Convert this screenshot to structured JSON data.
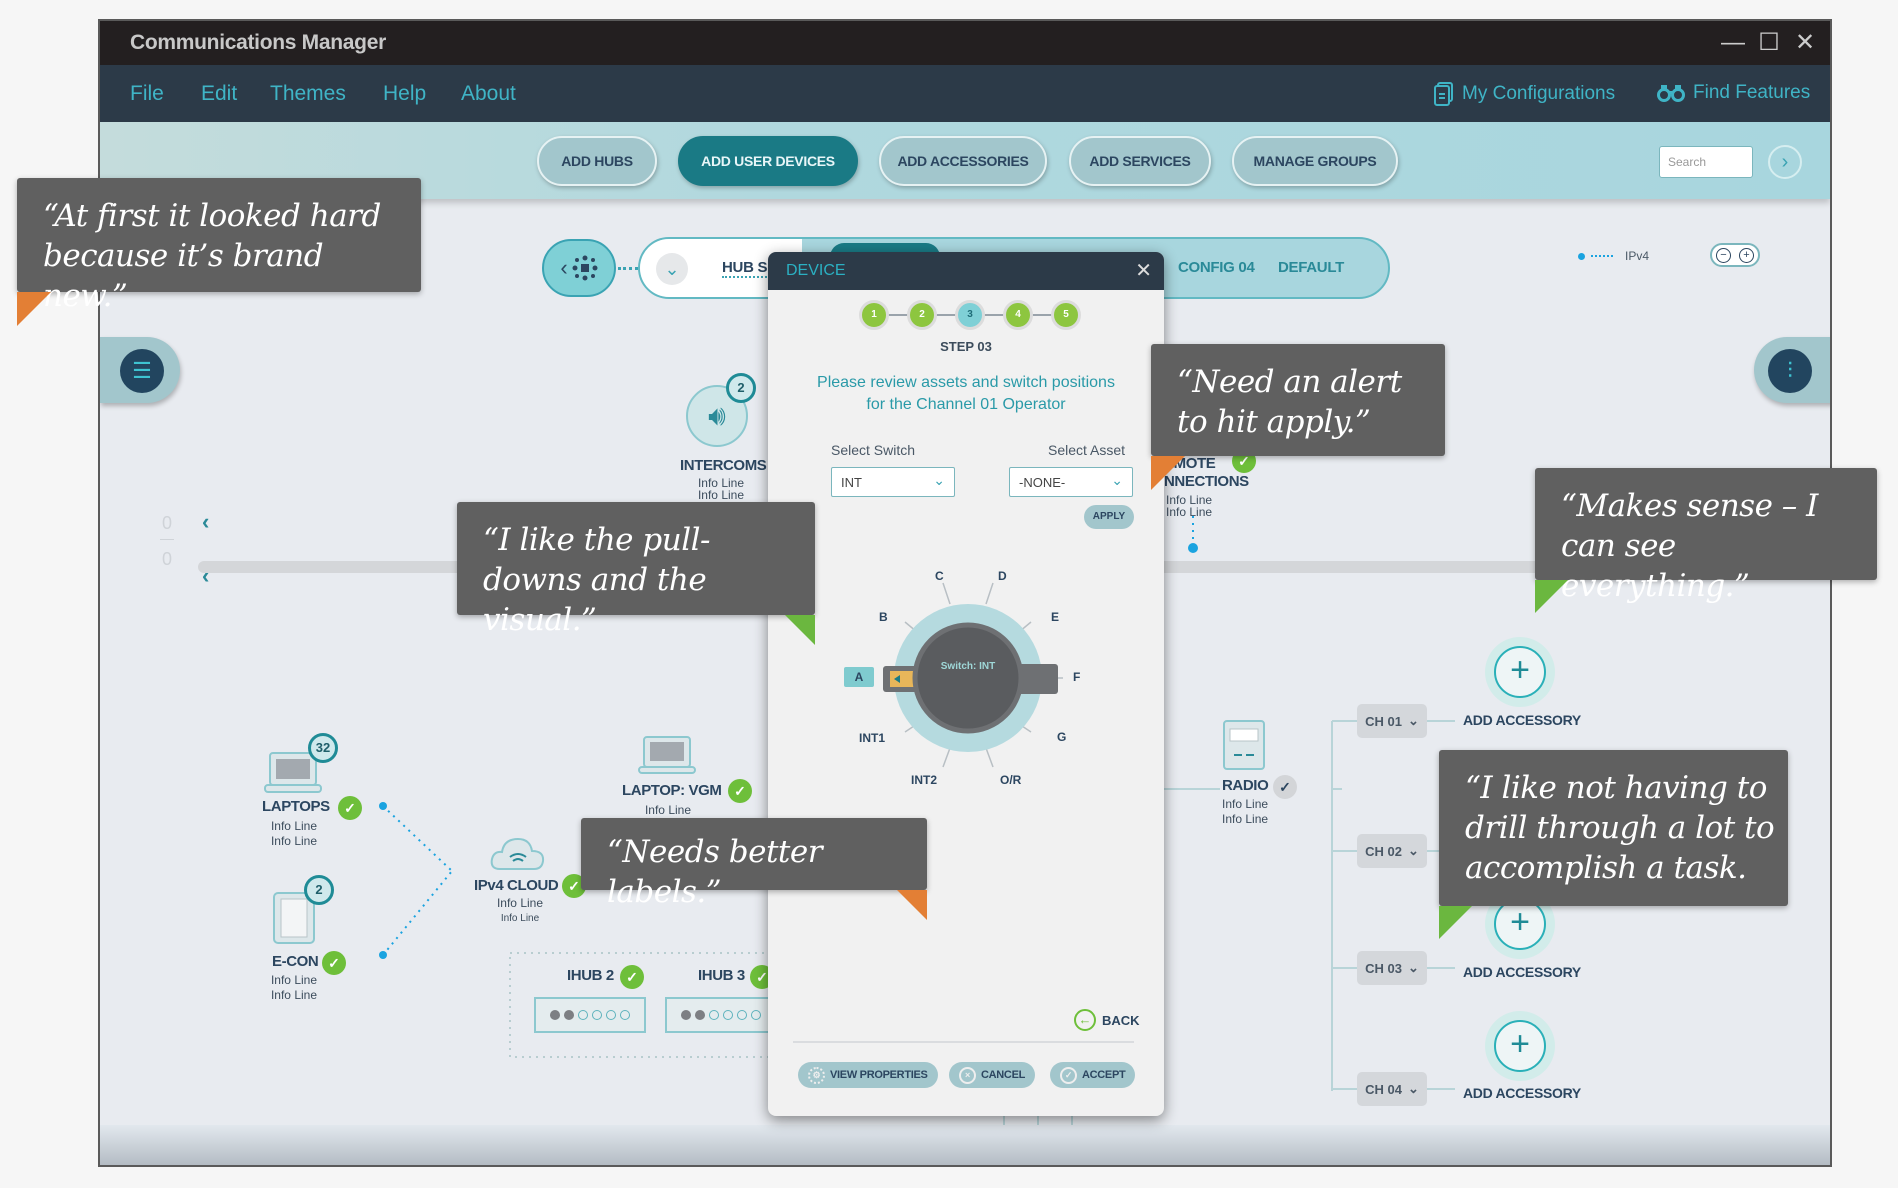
{
  "window": {
    "title": "Communications Manager",
    "controls": {
      "minimize": "—",
      "maximize": "☐",
      "close": "✕"
    }
  },
  "menu": {
    "items": [
      "File",
      "Edit",
      "Themes",
      "Help",
      "About"
    ],
    "right": [
      {
        "label": "My Configurations",
        "icon": "document-icon"
      },
      {
        "label": "Find Features",
        "icon": "binoculars-icon"
      }
    ]
  },
  "toolbar": {
    "buttons": [
      {
        "label": "ADD HUBS",
        "active": false
      },
      {
        "label": "ADD USER DEVICES",
        "active": true
      },
      {
        "label": "ADD ACCESSORIES",
        "active": false
      },
      {
        "label": "ADD SERVICES",
        "active": false
      },
      {
        "label": "MANAGE GROUPS",
        "active": false
      }
    ],
    "search_placeholder": "Search",
    "search_go": "›"
  },
  "hub_strip": {
    "tabs_visible": [
      "HUB S",
      "CONFIG 04",
      "DEFAULT"
    ],
    "chevron": "⌄",
    "back": "‹"
  },
  "legend": {
    "label": "IPv4",
    "zoom_minus": "−",
    "zoom_plus": "+"
  },
  "pager": {
    "top": "0",
    "bottom": "0",
    "prev": "‹"
  },
  "nodes": {
    "intercoms": {
      "name": "INTERCOMS",
      "badge": "2",
      "info": [
        "Info Line",
        "Info Line"
      ]
    },
    "remote": {
      "name_line1": "EMOTE",
      "name_line2": "NNECTIONS",
      "info": [
        "Info Line",
        "Info Line"
      ]
    },
    "laptops": {
      "name": "LAPTOPS",
      "badge": "32",
      "info": [
        "Info Line",
        "Info Line"
      ]
    },
    "econ": {
      "name": "E-CON",
      "badge": "2",
      "info": [
        "Info Line",
        "Info Line"
      ]
    },
    "laptop_vgm": {
      "name": "LAPTOP: VGM",
      "info": [
        "Info Line"
      ]
    },
    "cloud": {
      "name": "IPv4 CLOUD",
      "info": [
        "Info Line",
        "Info Line"
      ]
    },
    "ihub2": {
      "name": "IHUB 2"
    },
    "ihub3": {
      "name": "IHUB 3"
    },
    "radio": {
      "name": "RADIO",
      "info": [
        "Info Line",
        "Info Line"
      ]
    }
  },
  "channels": [
    {
      "label": "CH 01",
      "accessory": "ADD ACCESSORY"
    },
    {
      "label": "CH 02",
      "accessory": ""
    },
    {
      "label": "CH 03",
      "accessory": "ADD ACCESSORY"
    },
    {
      "label": "CH 04",
      "accessory": "ADD ACCESSORY"
    }
  ],
  "accessory_top": "ADD ACCESSORY",
  "dialog": {
    "title": "DEVICE",
    "close": "✕",
    "steps": [
      "1",
      "2",
      "3",
      "4",
      "5"
    ],
    "current_step": 3,
    "step_label": "STEP 03",
    "instructions_line1": "Please review assets and switch positions",
    "instructions_line2": "for the Channel 01 Operator",
    "select_switch_label": "Select Switch",
    "select_switch_value": "INT",
    "select_asset_label": "Select Asset",
    "select_asset_value": "-NONE-",
    "apply": "APPLY",
    "dial": {
      "center_text": "Switch: INT",
      "selected": "A",
      "positions": [
        "A",
        "B",
        "C",
        "D",
        "E",
        "F",
        "G",
        "O/R",
        "INT2",
        "INT1"
      ]
    },
    "back": "BACK",
    "buttons": {
      "view_properties": "VIEW PROPERTIES",
      "cancel": "CANCEL",
      "accept": "ACCEPT"
    }
  },
  "callouts": [
    {
      "text": "“At first it looked hard because it’s brand new.”",
      "tail_color": "#e37f35"
    },
    {
      "text": "“Need an alert to hit apply.”",
      "tail_color": "#e37f35"
    },
    {
      "text": "“I like the pull-downs and the visual.”",
      "tail_color": "#6bb73f"
    },
    {
      "text": "“Makes sense – I can see everything.”",
      "tail_color": "#6bb73f"
    },
    {
      "text": "“Needs better labels.”",
      "tail_color": "#e37f35"
    },
    {
      "text": "“I like not having to drill through a lot to accomplish a task.",
      "tail_color": "#6bb73f"
    }
  ],
  "colors": {
    "titlebar": "#231f20",
    "menubar": "#2c3a48",
    "accent": "#3fb4c6",
    "active_button": "#1a7a85",
    "check_green": "#6ebf3a",
    "callout_bg": "#606060"
  }
}
